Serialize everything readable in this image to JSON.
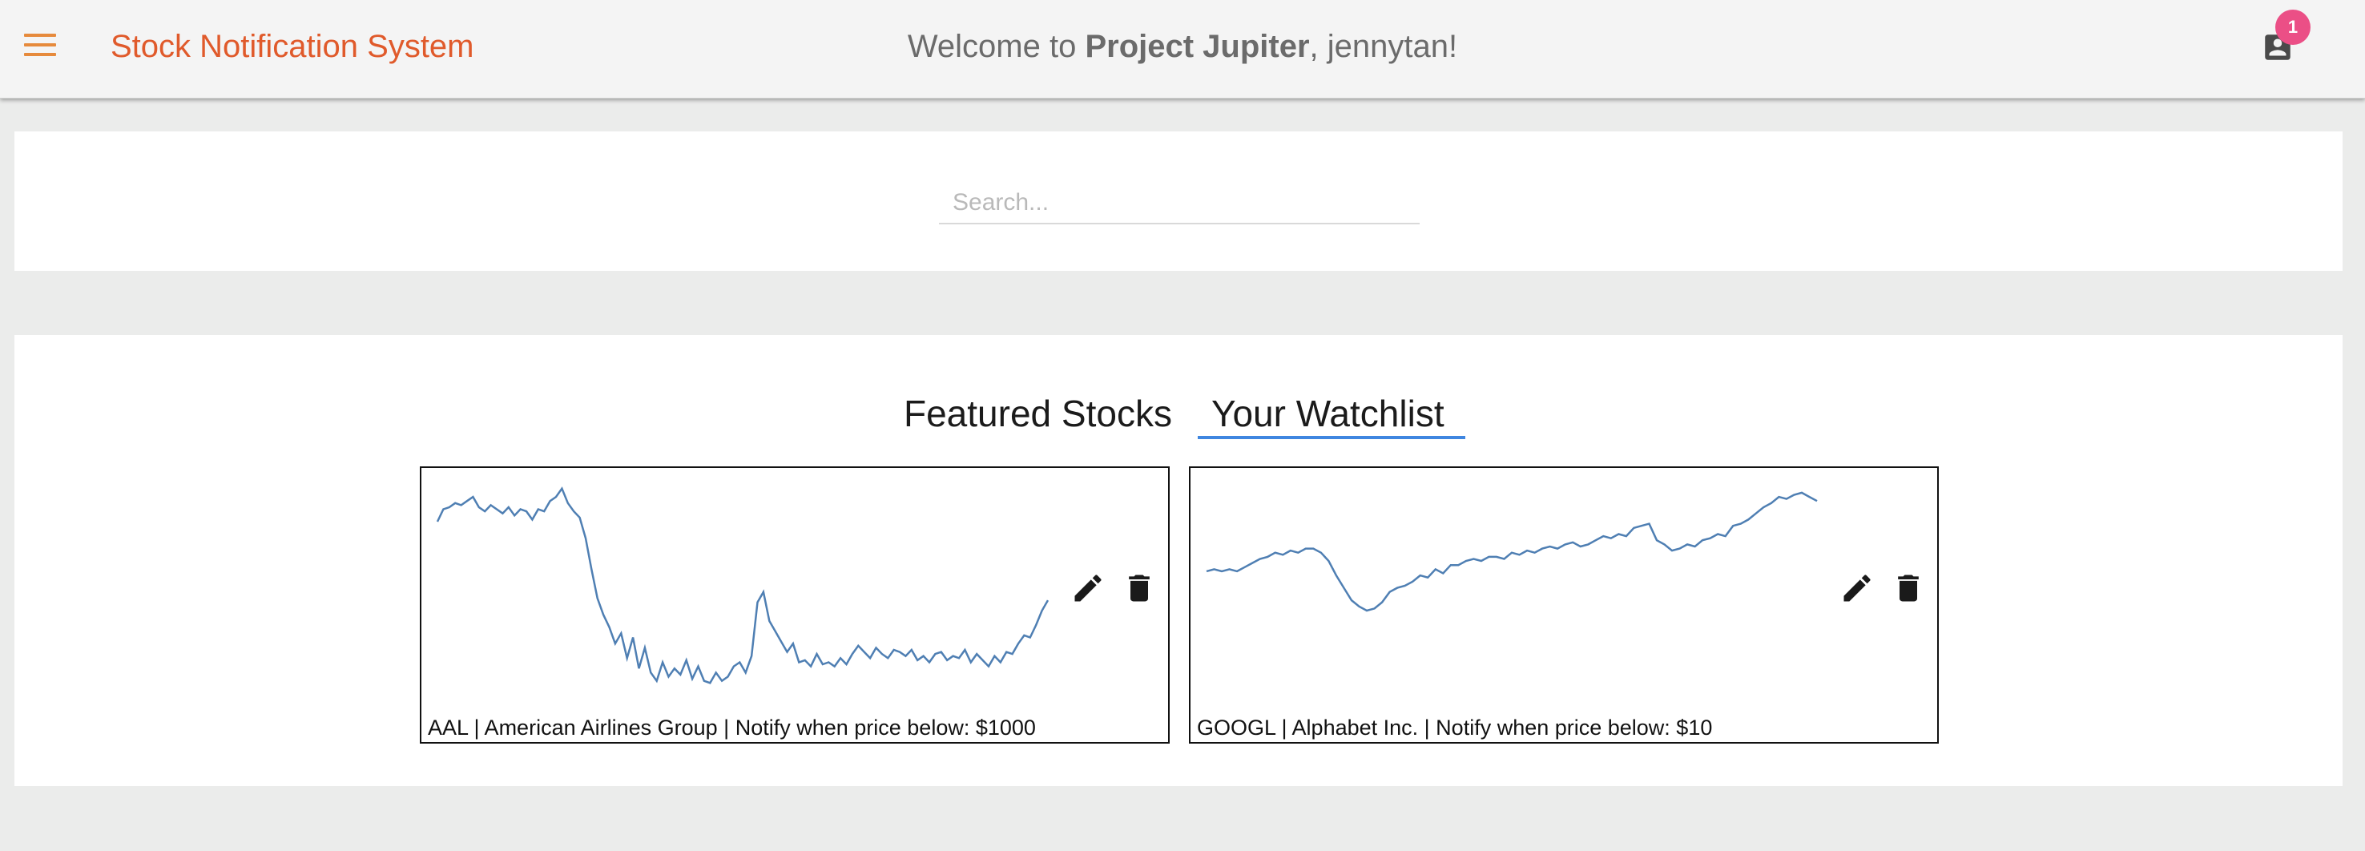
{
  "header": {
    "app_title": "Stock Notification System",
    "welcome_prefix": "Welcome to ",
    "project_name": "Project Jupiter",
    "welcome_separator": ",  ",
    "username": "jennytan!",
    "notification_count": "1",
    "menu_icon": "hamburger-menu-icon",
    "account_icon": "account-box-icon"
  },
  "search": {
    "placeholder": "Search...",
    "value": ""
  },
  "tabs": [
    {
      "label": "Featured Stocks",
      "active": false
    },
    {
      "label": "Your Watchlist",
      "active": true
    }
  ],
  "watchlist": [
    {
      "label": "AAL | American Airlines Group | Notify when price below: $1000",
      "ticker": "AAL",
      "name": "American Airlines Group",
      "threshold": "$1000",
      "actions": [
        "edit-icon",
        "delete-icon"
      ],
      "trend": [
        0.81,
        0.87,
        0.88,
        0.9,
        0.89,
        0.91,
        0.93,
        0.88,
        0.86,
        0.89,
        0.87,
        0.85,
        0.88,
        0.84,
        0.87,
        0.86,
        0.82,
        0.87,
        0.86,
        0.91,
        0.93,
        0.97,
        0.9,
        0.86,
        0.83,
        0.73,
        0.58,
        0.44,
        0.36,
        0.3,
        0.22,
        0.27,
        0.15,
        0.25,
        0.1,
        0.2,
        0.08,
        0.04,
        0.13,
        0.06,
        0.1,
        0.07,
        0.14,
        0.05,
        0.11,
        0.04,
        0.03,
        0.08,
        0.04,
        0.06,
        0.11,
        0.13,
        0.08,
        0.16,
        0.42,
        0.47,
        0.33,
        0.28,
        0.23,
        0.18,
        0.22,
        0.13,
        0.14,
        0.11,
        0.17,
        0.12,
        0.13,
        0.11,
        0.15,
        0.12,
        0.17,
        0.21,
        0.18,
        0.15,
        0.2,
        0.17,
        0.15,
        0.19,
        0.18,
        0.16,
        0.19,
        0.14,
        0.16,
        0.13,
        0.17,
        0.18,
        0.14,
        0.16,
        0.15,
        0.19,
        0.13,
        0.17,
        0.14,
        0.11,
        0.16,
        0.13,
        0.18,
        0.17,
        0.22,
        0.26,
        0.25,
        0.31,
        0.38,
        0.43
      ]
    },
    {
      "label": "GOOGL | Alphabet Inc. | Notify when price below: $10",
      "ticker": "GOOGL",
      "name": "Alphabet Inc.",
      "threshold": "$10",
      "actions": [
        "edit-icon",
        "delete-icon"
      ],
      "trend": [
        0.57,
        0.58,
        0.57,
        0.58,
        0.57,
        0.59,
        0.61,
        0.63,
        0.64,
        0.66,
        0.65,
        0.67,
        0.66,
        0.68,
        0.68,
        0.66,
        0.62,
        0.55,
        0.49,
        0.43,
        0.4,
        0.38,
        0.39,
        0.42,
        0.47,
        0.49,
        0.5,
        0.52,
        0.55,
        0.54,
        0.58,
        0.56,
        0.6,
        0.6,
        0.62,
        0.63,
        0.62,
        0.64,
        0.64,
        0.63,
        0.66,
        0.65,
        0.67,
        0.66,
        0.68,
        0.69,
        0.68,
        0.7,
        0.71,
        0.69,
        0.7,
        0.72,
        0.74,
        0.73,
        0.75,
        0.74,
        0.78,
        0.79,
        0.8,
        0.72,
        0.7,
        0.67,
        0.68,
        0.7,
        0.69,
        0.72,
        0.73,
        0.75,
        0.74,
        0.79,
        0.8,
        0.82,
        0.85,
        0.88,
        0.9,
        0.93,
        0.92,
        0.94,
        0.95,
        0.93,
        0.91
      ]
    }
  ],
  "colors": {
    "app_title": "#e05a2b",
    "menu_icon": "#e68a3c",
    "badge": "#eb4f86",
    "tab_underline": "#3f86e0",
    "line": "#4f7fb3"
  }
}
